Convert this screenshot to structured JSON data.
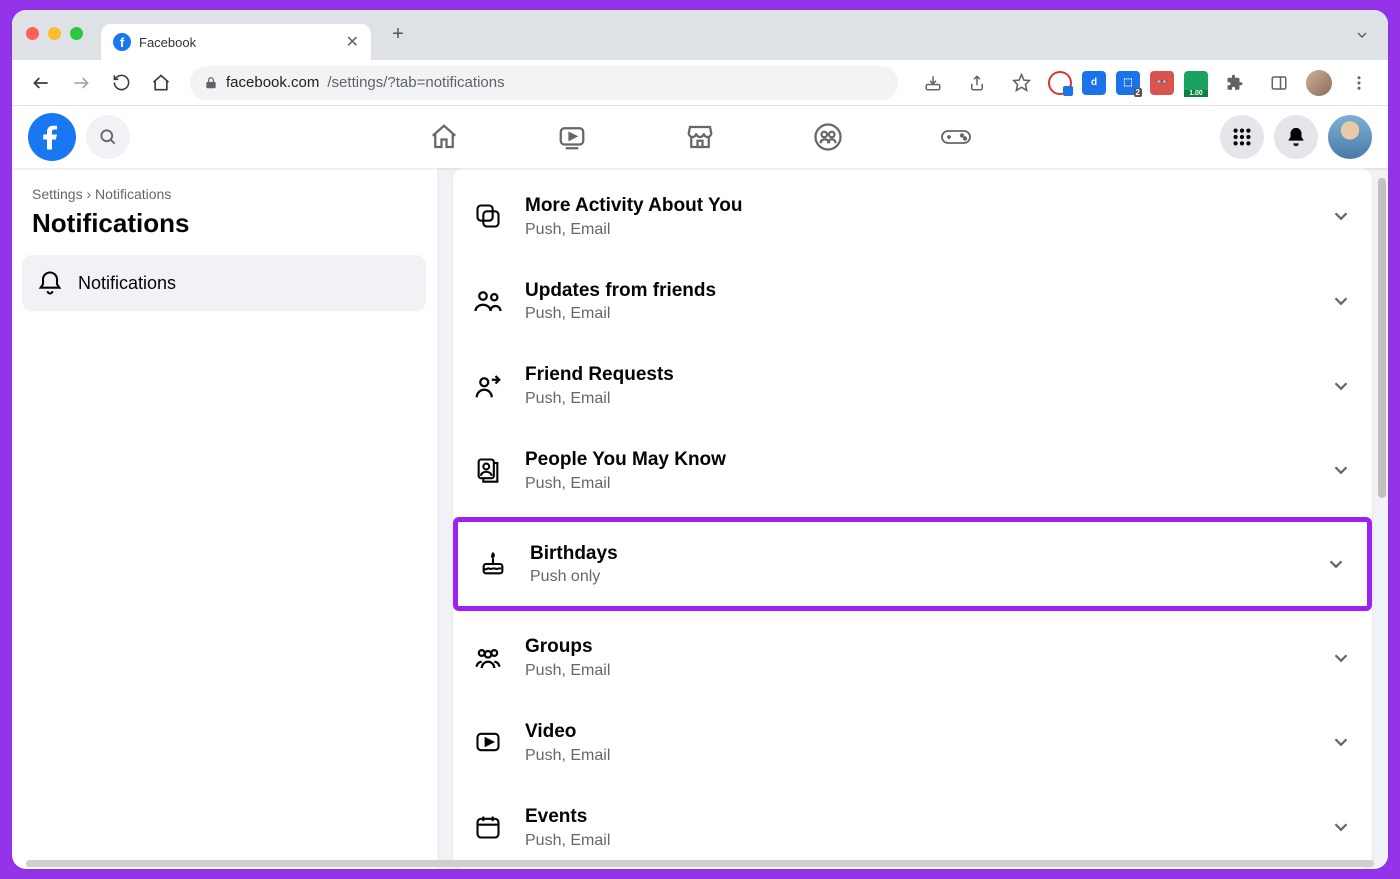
{
  "browser": {
    "tab_title": "Facebook",
    "url_host": "facebook.com",
    "url_path": "/settings/?tab=notifications"
  },
  "fb": {
    "breadcrumb_settings": "Settings",
    "breadcrumb_separator": "›",
    "breadcrumb_current": "Notifications",
    "page_title": "Notifications",
    "side_item": "Notifications"
  },
  "rows": [
    {
      "title": "More Activity About You",
      "sub": "Push, Email"
    },
    {
      "title": "Updates from friends",
      "sub": "Push, Email"
    },
    {
      "title": "Friend Requests",
      "sub": "Push, Email"
    },
    {
      "title": "People You May Know",
      "sub": "Push, Email"
    },
    {
      "title": "Birthdays",
      "sub": "Push only"
    },
    {
      "title": "Groups",
      "sub": "Push, Email"
    },
    {
      "title": "Video",
      "sub": "Push, Email"
    },
    {
      "title": "Events",
      "sub": "Push, Email"
    }
  ]
}
